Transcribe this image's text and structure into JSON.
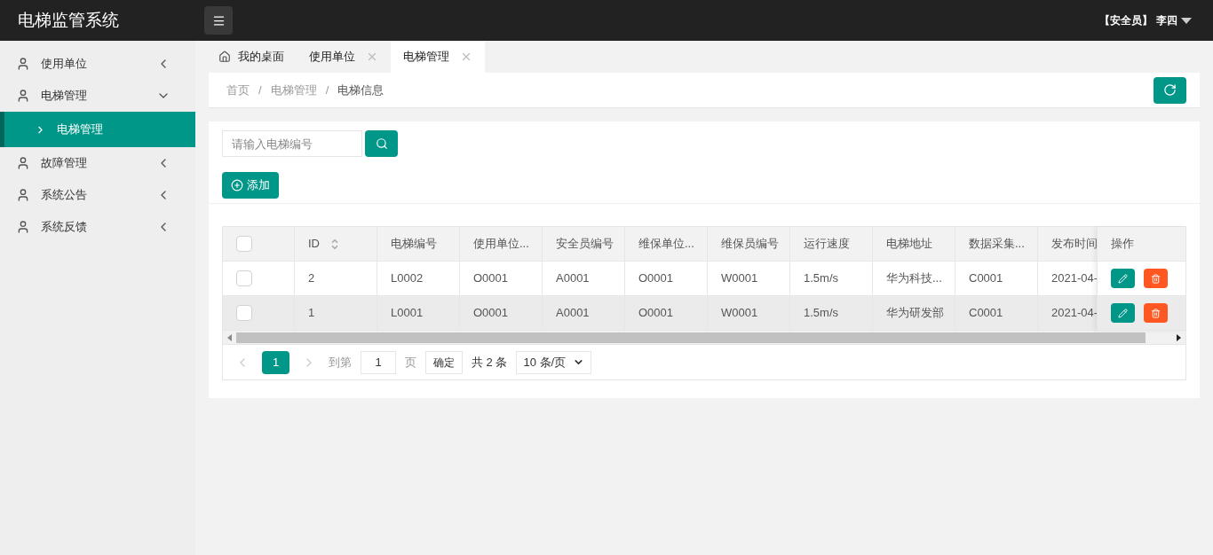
{
  "header": {
    "title": "电梯监管系统",
    "role": "【安全员】",
    "user": "李四"
  },
  "sidebar": {
    "items": [
      {
        "label": "使用单位",
        "expanded": false
      },
      {
        "label": "电梯管理",
        "expanded": true,
        "children": [
          {
            "label": "电梯管理",
            "selected": true
          }
        ]
      },
      {
        "label": "故障管理",
        "expanded": false
      },
      {
        "label": "系统公告",
        "expanded": false
      },
      {
        "label": "系统反馈",
        "expanded": false
      }
    ]
  },
  "tabs": [
    {
      "label": "我的桌面",
      "kind": "home",
      "selected": false
    },
    {
      "label": "使用单位",
      "kind": "closable",
      "selected": false
    },
    {
      "label": "电梯管理",
      "kind": "closable",
      "selected": true
    }
  ],
  "breadcrumb": [
    "首页",
    "电梯管理",
    "电梯信息"
  ],
  "breadcrumb_separator": "/",
  "search": {
    "placeholder": "请输入电梯编号"
  },
  "add_button": "添加",
  "table": {
    "header_checked": false,
    "columns": [
      "ID",
      "电梯编号",
      "使用单位...",
      "安全员编号",
      "维保单位...",
      "维保员编号",
      "运行速度",
      "电梯地址",
      "数据采集...",
      "发布时间"
    ],
    "actions_column": "操作",
    "rows": [
      {
        "checked": false,
        "highlighted": false,
        "cells": [
          "2",
          "L0002",
          "O0001",
          "A0001",
          "O0001",
          "W0001",
          "1.5m/s",
          "华为科技...",
          "C0001",
          "2021-04-"
        ]
      },
      {
        "checked": false,
        "highlighted": true,
        "cells": [
          "1",
          "L0001",
          "O0001",
          "A0001",
          "O0001",
          "W0001",
          "1.5m/s",
          "华为研发部",
          "C0001",
          "2021-04-"
        ]
      }
    ]
  },
  "pagination": {
    "pages": [
      {
        "label": "1",
        "selected": true
      }
    ],
    "goto_label": "到第",
    "goto_value": "1",
    "page_label": "页",
    "confirm": "确定",
    "total": "共 2 条",
    "page_size": "10 条/页"
  }
}
